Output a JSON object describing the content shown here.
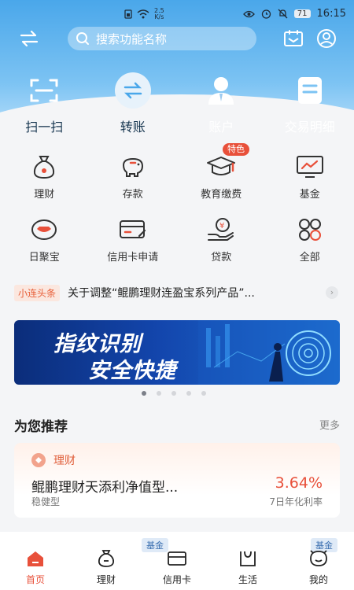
{
  "status_bar": {
    "net_speed": "2.5",
    "net_unit": "K/s",
    "battery": "71",
    "time": "16:15"
  },
  "search": {
    "placeholder": "搜索功能名称"
  },
  "quick_actions": [
    {
      "label": "扫一扫",
      "icon": "scan-icon"
    },
    {
      "label": "转账",
      "icon": "transfer-icon"
    },
    {
      "label": "账户",
      "icon": "account-icon"
    },
    {
      "label": "交易明细",
      "icon": "transaction-details-icon"
    }
  ],
  "services": [
    {
      "label": "理财",
      "icon": "wealth-bag-icon"
    },
    {
      "label": "存款",
      "icon": "piggy-bank-icon"
    },
    {
      "label": "教育缴费",
      "icon": "graduation-cap-icon",
      "badge": "特色"
    },
    {
      "label": "基金",
      "icon": "fund-chart-icon"
    },
    {
      "label": "日聚宝",
      "icon": "gold-ingot-icon"
    },
    {
      "label": "信用卡申请",
      "icon": "credit-card-apply-icon"
    },
    {
      "label": "贷款",
      "icon": "loan-icon"
    },
    {
      "label": "全部",
      "icon": "all-services-icon"
    }
  ],
  "news": {
    "tag": "小连头条",
    "text": "关于调整“鲲鹏理财连盈宝系列产品”..."
  },
  "banner": {
    "line1": "指纹识别",
    "line2": "安全快捷",
    "page_count": 5,
    "active_page": 1
  },
  "recommend": {
    "title": "为您推荐",
    "more": "更多",
    "card": {
      "category": "理财",
      "name": "鲲鹏理财天添利净值型...",
      "risk": "稳健型",
      "rate": "3.64%",
      "rate_label": "7日年化利率"
    }
  },
  "peek_tags": [
    "基金",
    "基金"
  ],
  "bottom_nav": [
    {
      "label": "首页",
      "active": true
    },
    {
      "label": "理财",
      "active": false
    },
    {
      "label": "信用卡",
      "active": false
    },
    {
      "label": "生活",
      "active": false
    },
    {
      "label": "我的",
      "active": false
    }
  ],
  "colors": {
    "accent": "#e8503a",
    "header_blue": "#4aa7ea",
    "banner_blue": "#1346ad"
  }
}
